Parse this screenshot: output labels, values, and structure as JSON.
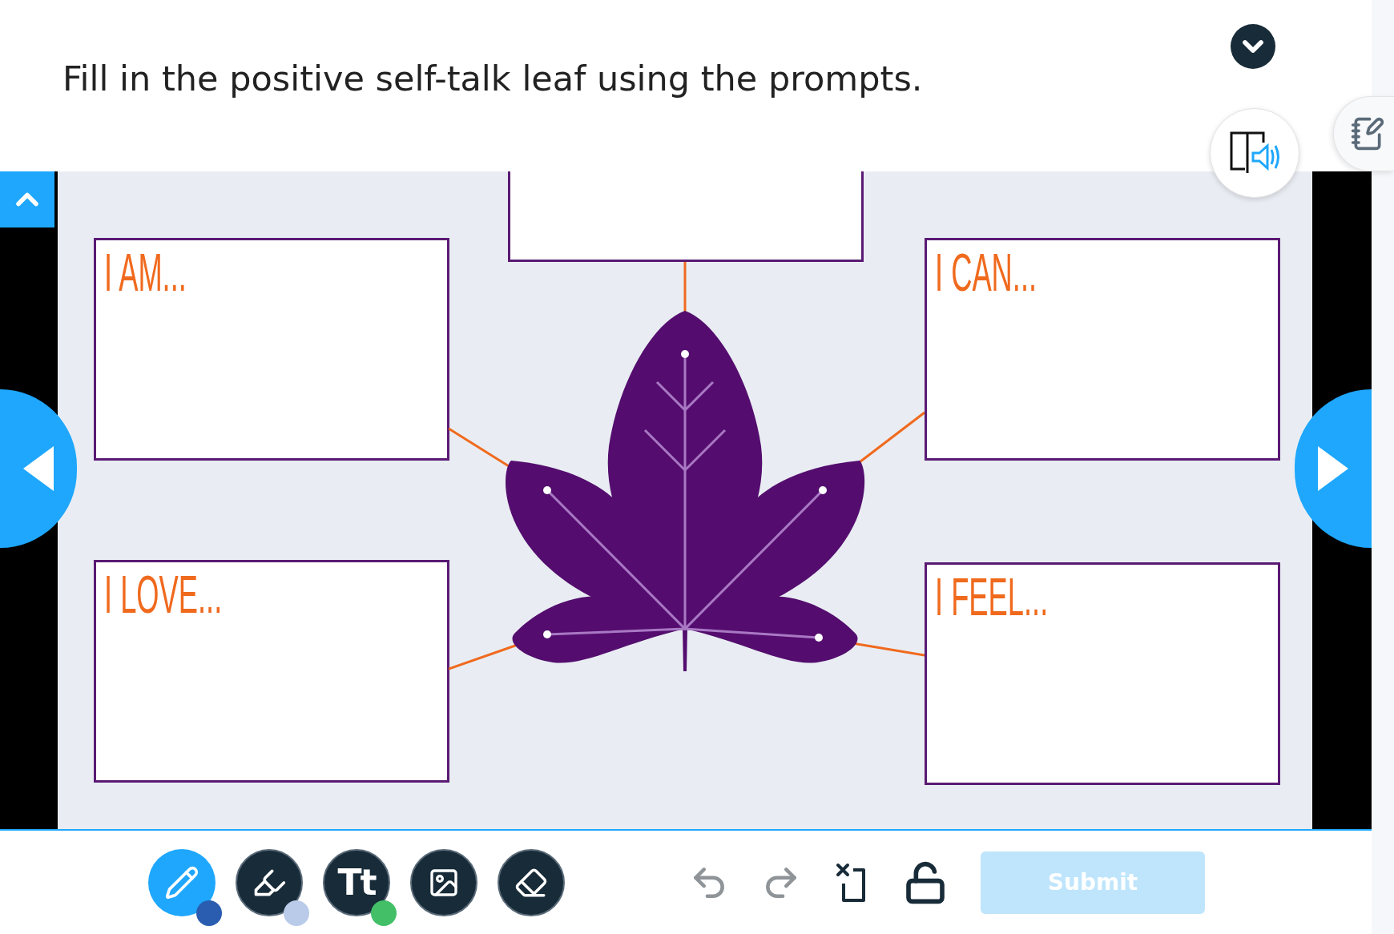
{
  "instruction": "Fill in the positive self-talk leaf using the prompts.",
  "left_prompts": [
    {
      "label": "I AM..."
    },
    {
      "label": "I LOVE..."
    }
  ],
  "right_prompts": [
    {
      "label": "I CAN..."
    },
    {
      "label": "I FEEL..."
    }
  ],
  "tools": [
    {
      "kind": "pen",
      "selected": true,
      "color": "#2a5db0"
    },
    {
      "kind": "highlighter",
      "selected": false,
      "color": "#b9cbe9"
    },
    {
      "kind": "text",
      "label": "Tt",
      "selected": false,
      "color": "#43bf68"
    },
    {
      "kind": "image",
      "selected": false
    },
    {
      "kind": "eraser",
      "selected": false
    }
  ],
  "actions": [
    {
      "kind": "undo",
      "disabled": true
    },
    {
      "kind": "redo",
      "disabled": true
    },
    {
      "kind": "clear",
      "disabled": false
    },
    {
      "kind": "lock",
      "disabled": false
    }
  ],
  "submit": {
    "label": "Submit",
    "disabled": true
  }
}
